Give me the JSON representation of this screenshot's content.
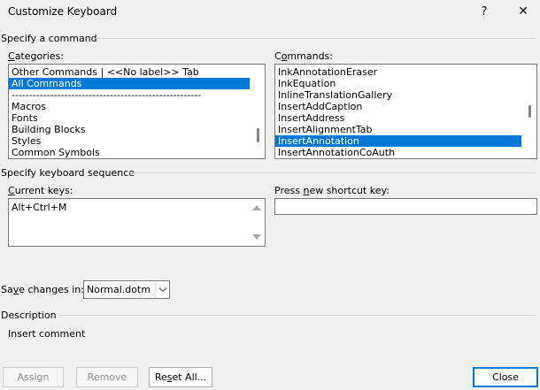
{
  "window": {
    "title": "Customize Keyboard",
    "help_glyph": "?",
    "close_glyph": "✕"
  },
  "specify_command": {
    "group_label": "Specify a command",
    "categories_label_pre": "",
    "categories_label_key": "C",
    "categories_label_post": "ategories:",
    "categories": [
      {
        "label": "Other Commands | <<No label>> Tab",
        "selected": false
      },
      {
        "label": "All Commands",
        "selected": true
      },
      {
        "label": "------------------------------------------------------",
        "selected": false
      },
      {
        "label": "Macros",
        "selected": false
      },
      {
        "label": "Fonts",
        "selected": false
      },
      {
        "label": "Building Blocks",
        "selected": false
      },
      {
        "label": "Styles",
        "selected": false
      },
      {
        "label": "Common Symbols",
        "selected": false
      }
    ],
    "commands_label_pre": "C",
    "commands_label_key": "o",
    "commands_label_post": "mmands:",
    "commands": [
      {
        "label": "InkAnnotationEraser",
        "selected": false
      },
      {
        "label": "InkEquation",
        "selected": false
      },
      {
        "label": "InlineTranslationGallery",
        "selected": false
      },
      {
        "label": "InsertAddCaption",
        "selected": false
      },
      {
        "label": "InsertAddress",
        "selected": false
      },
      {
        "label": "InsertAlignmentTab",
        "selected": false
      },
      {
        "label": "InsertAnnotation",
        "selected": true
      },
      {
        "label": "InsertAnnotationCoAuth",
        "selected": false
      }
    ]
  },
  "keyboard_sequence": {
    "group_label": "Specify keyboard sequence",
    "current_keys_label_pre": "",
    "current_keys_label_key": "C",
    "current_keys_label_post": "urrent keys:",
    "current_keys": [
      "Alt+Ctrl+M"
    ],
    "new_key_label_pre": "Press ",
    "new_key_label_key": "n",
    "new_key_label_post": "ew shortcut key:",
    "new_key_value": ""
  },
  "save_changes": {
    "label_pre": "Sa",
    "label_key": "v",
    "label_post": "e changes in:",
    "value": "Normal.dotm"
  },
  "description": {
    "group_label": "Description",
    "text": "Insert comment"
  },
  "buttons": {
    "assign": "Assign",
    "remove": "Remove",
    "reset_pre": "Re",
    "reset_key": "s",
    "reset_post": "et All...",
    "close": "Close"
  }
}
